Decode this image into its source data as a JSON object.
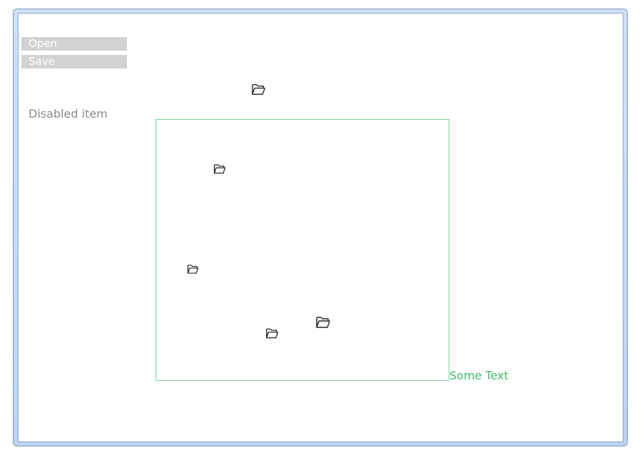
{
  "menu": {
    "open_label": "Open",
    "save_label": "Save"
  },
  "disabled_item": "Disabled item",
  "some_text": "Some Text",
  "colors": {
    "drop_area_border": "#7fd19a",
    "some_text": "#43b96a",
    "menu_button_bg": "#d2d2d2",
    "disabled_text": "#8a8a8a"
  },
  "icons": {
    "folder": "folder-open-icon"
  }
}
